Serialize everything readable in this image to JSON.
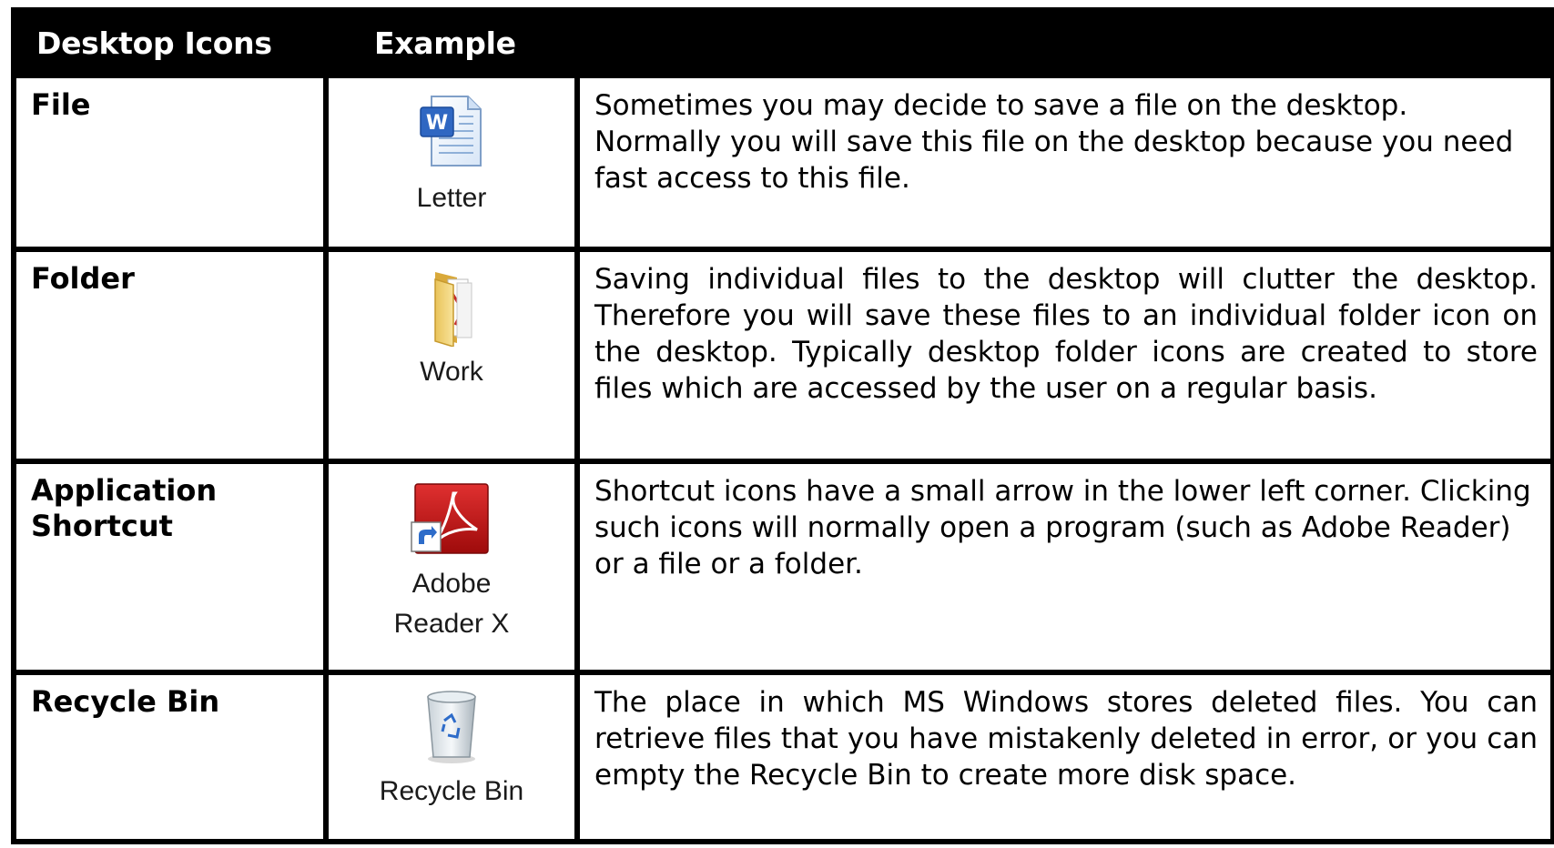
{
  "table": {
    "headers": [
      "Desktop Icons",
      "Example",
      ""
    ],
    "rows": [
      {
        "name": "File",
        "icon": "word-document-icon",
        "icon_label": "Letter",
        "description": "Sometimes you may decide to save a file on the desktop. Normally you will save this file on the desktop because you need fast access to this file."
      },
      {
        "name": "Folder",
        "icon": "folder-icon",
        "icon_label": "Work",
        "description": "Saving individual files to the desktop will clutter the desktop. Therefore you will save these files to an individual folder icon on the desktop. Typically desktop folder icons are created to store files which are accessed by the user on a regular basis."
      },
      {
        "name": "Application Shortcut",
        "icon": "adobe-reader-shortcut-icon",
        "icon_label": "Adobe Reader X",
        "description": "Shortcut icons have a small arrow in the lower left corner. Clicking such icons will normally open a program (such as Adobe Reader) or a file or a folder."
      },
      {
        "name": "Recycle Bin",
        "icon": "recycle-bin-icon",
        "icon_label": "Recycle Bin",
        "description": "The place in which MS Windows stores deleted files. You can retrieve files that you have mistakenly deleted in error, or you can empty the Recycle Bin to create more disk space."
      }
    ]
  }
}
